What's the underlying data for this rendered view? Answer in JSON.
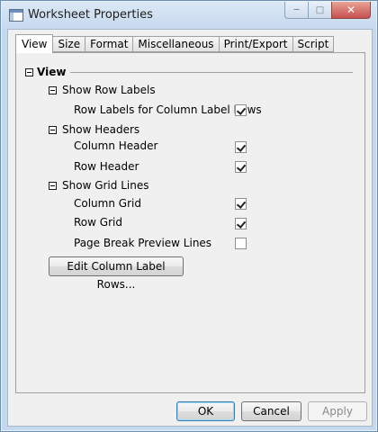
{
  "window": {
    "title": "Worksheet Properties",
    "icon": "window-icon"
  },
  "caption": {
    "minimize": "minimize-icon",
    "maximize": "maximize-icon",
    "close": "close-icon"
  },
  "tabs": [
    {
      "label": "View",
      "active": true
    },
    {
      "label": "Size",
      "active": false
    },
    {
      "label": "Format",
      "active": false
    },
    {
      "label": "Miscellaneous",
      "active": false
    },
    {
      "label": "Print/Export",
      "active": false
    },
    {
      "label": "Script",
      "active": false
    }
  ],
  "view": {
    "heading": "View",
    "show_row_labels": {
      "label": "Show Row Labels",
      "row_labels_for_column_label_rows": {
        "label": "Row Labels for Column Label Rows",
        "checked": true
      }
    },
    "show_headers": {
      "label": "Show Headers",
      "column_header": {
        "label": "Column Header",
        "checked": true
      },
      "row_header": {
        "label": "Row Header",
        "checked": true
      }
    },
    "show_grid_lines": {
      "label": "Show Grid Lines",
      "column_grid": {
        "label": "Column Grid",
        "checked": true
      },
      "row_grid": {
        "label": "Row Grid",
        "checked": true
      },
      "page_break_preview_lines": {
        "label": "Page Break Preview Lines",
        "checked": false
      }
    },
    "edit_column_label_rows": "Edit Column Label Rows..."
  },
  "buttons": {
    "ok": "OK",
    "cancel": "Cancel",
    "apply": "Apply"
  }
}
